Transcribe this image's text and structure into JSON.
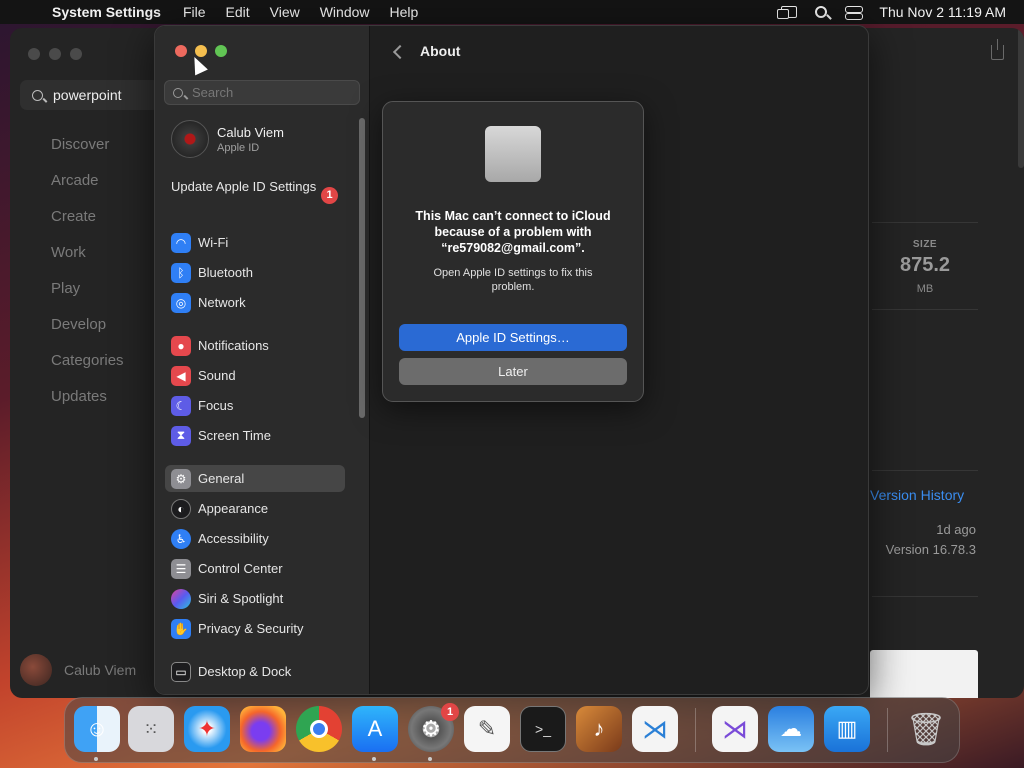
{
  "menubar": {
    "app_name": "System Settings",
    "items": [
      "File",
      "Edit",
      "View",
      "Window",
      "Help"
    ],
    "clock": "Thu Nov 2  11:19 AM"
  },
  "app_store": {
    "search_value": "powerpoint",
    "nav": [
      "Discover",
      "Arcade",
      "Create",
      "Work",
      "Play",
      "Develop",
      "Categories",
      "Updates"
    ],
    "user_name": "Calub Viem",
    "size_label": "SIZE",
    "size_value": "875.2",
    "size_unit": "MB",
    "version_history": "Version History",
    "updated_ago": "1d ago",
    "version": "Version 16.78.3"
  },
  "settings": {
    "search_placeholder": "Search",
    "profile_name": "Calub Viem",
    "profile_sub": "Apple ID",
    "update_label": "Update Apple ID Settings",
    "update_badge": "1",
    "items": [
      {
        "label": "Wi-Fi",
        "color": "#2f7ff5"
      },
      {
        "label": "Bluetooth",
        "color": "#2f7ff5"
      },
      {
        "label": "Network",
        "color": "#2f7ff5"
      },
      {
        "label": "Notifications",
        "color": "#e5484d"
      },
      {
        "label": "Sound",
        "color": "#e5484d"
      },
      {
        "label": "Focus",
        "color": "#5e5ce6"
      },
      {
        "label": "Screen Time",
        "color": "#5e5ce6"
      },
      {
        "label": "General",
        "color": "#8e8e93"
      },
      {
        "label": "Appearance",
        "color": "#1c1c1e"
      },
      {
        "label": "Accessibility",
        "color": "#2f7ff5"
      },
      {
        "label": "Control Center",
        "color": "#8e8e93"
      },
      {
        "label": "Siri & Spotlight",
        "color": "#b44bd6"
      },
      {
        "label": "Privacy & Security",
        "color": "#2f7ff5"
      },
      {
        "label": "Desktop & Dock",
        "color": "#1c1c1e"
      }
    ],
    "page_title": "About"
  },
  "alert": {
    "title": "This Mac can’t connect to iCloud because of a problem with “re579082@gmail.com”.",
    "message": "Open Apple ID settings to fix this problem.",
    "primary_button": "Apple ID Settings…",
    "secondary_button": "Later"
  },
  "dock": {
    "settings_badge": "1"
  }
}
